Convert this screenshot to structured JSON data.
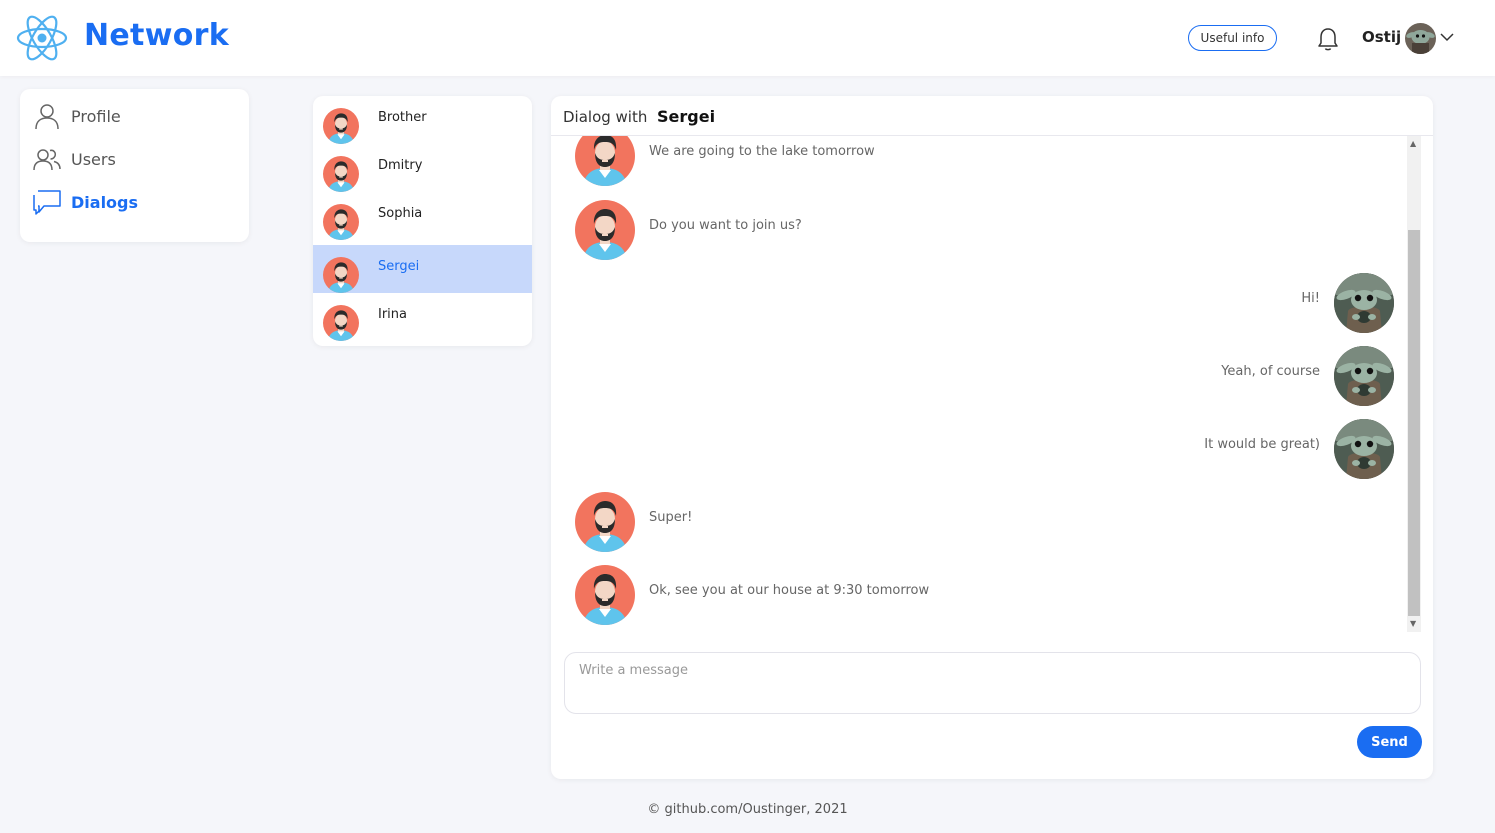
{
  "header": {
    "brand": "Network",
    "useful_info_label": "Useful info",
    "user_name": "Ostij",
    "logo_icon": "react-atom-icon",
    "accent": "#1a6df2"
  },
  "sidebar": {
    "items": [
      {
        "label": "Profile",
        "icon": "user-icon",
        "active": false
      },
      {
        "label": "Users",
        "icon": "users-icon",
        "active": false
      },
      {
        "label": "Dialogs",
        "icon": "chat-bubble-icon",
        "active": true
      }
    ]
  },
  "dialogs": {
    "items": [
      {
        "name": "Brother",
        "active": false
      },
      {
        "name": "Dmitry",
        "active": false
      },
      {
        "name": "Sophia",
        "active": false
      },
      {
        "name": "Sergei",
        "active": true
      },
      {
        "name": "Irina",
        "active": false
      }
    ]
  },
  "chat": {
    "heading_prefix": "Dialog with",
    "partner": "Sergei",
    "messages": [
      {
        "text": "We are going to the lake tomorrow",
        "from": "partner"
      },
      {
        "text": "Do you want to join us?",
        "from": "partner"
      },
      {
        "text": "Hi!",
        "from": "me"
      },
      {
        "text": "Yeah, of course",
        "from": "me"
      },
      {
        "text": "It would be great)",
        "from": "me"
      },
      {
        "text": "Super!",
        "from": "partner"
      },
      {
        "text": "Ok, see you at our house at 9:30 tomorrow",
        "from": "partner"
      }
    ],
    "input_placeholder": "Write a message",
    "input_value": "",
    "send_label": "Send"
  },
  "footer": {
    "text": "© github.com/Oustinger, 2021"
  }
}
